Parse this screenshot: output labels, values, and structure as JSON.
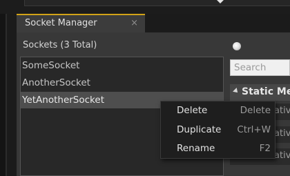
{
  "tab": {
    "title": "Socket Manager",
    "close_glyph": "×"
  },
  "sockets": {
    "header": "Sockets (3 Total)",
    "items": [
      {
        "label": "SomeSocket"
      },
      {
        "label": "AnotherSocket"
      },
      {
        "label": "YetAnotherSocket"
      }
    ]
  },
  "search": {
    "placeholder": "Search"
  },
  "details": {
    "section_title": "Static Me",
    "row_labels": [
      "ative",
      "ative",
      "ative"
    ]
  },
  "context_menu": {
    "items": [
      {
        "label": "Delete",
        "shortcut": "Delete"
      },
      {
        "label": "Duplicate",
        "shortcut": "Ctrl+W"
      },
      {
        "label": "Rename",
        "shortcut": "F2"
      }
    ]
  },
  "colors": {
    "tab_accent": "#d2a317",
    "panel_bg": "#383838",
    "list_bg": "#282828",
    "selected_row": "#4e4e4e",
    "menu_bg": "#1e1e1e"
  }
}
